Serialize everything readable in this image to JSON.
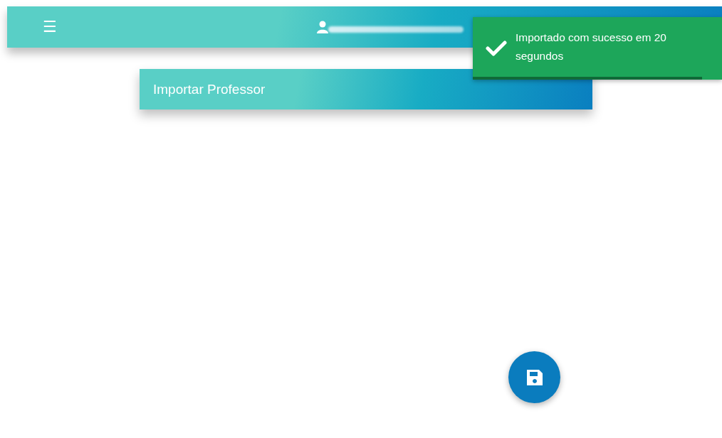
{
  "header": {
    "menu_icon": "☰"
  },
  "page_card": {
    "title": "Importar Professor"
  },
  "toast": {
    "message": "Importado com sucesso em 20 segundos",
    "level": 0.92
  },
  "fab": {
    "kind": "save"
  }
}
